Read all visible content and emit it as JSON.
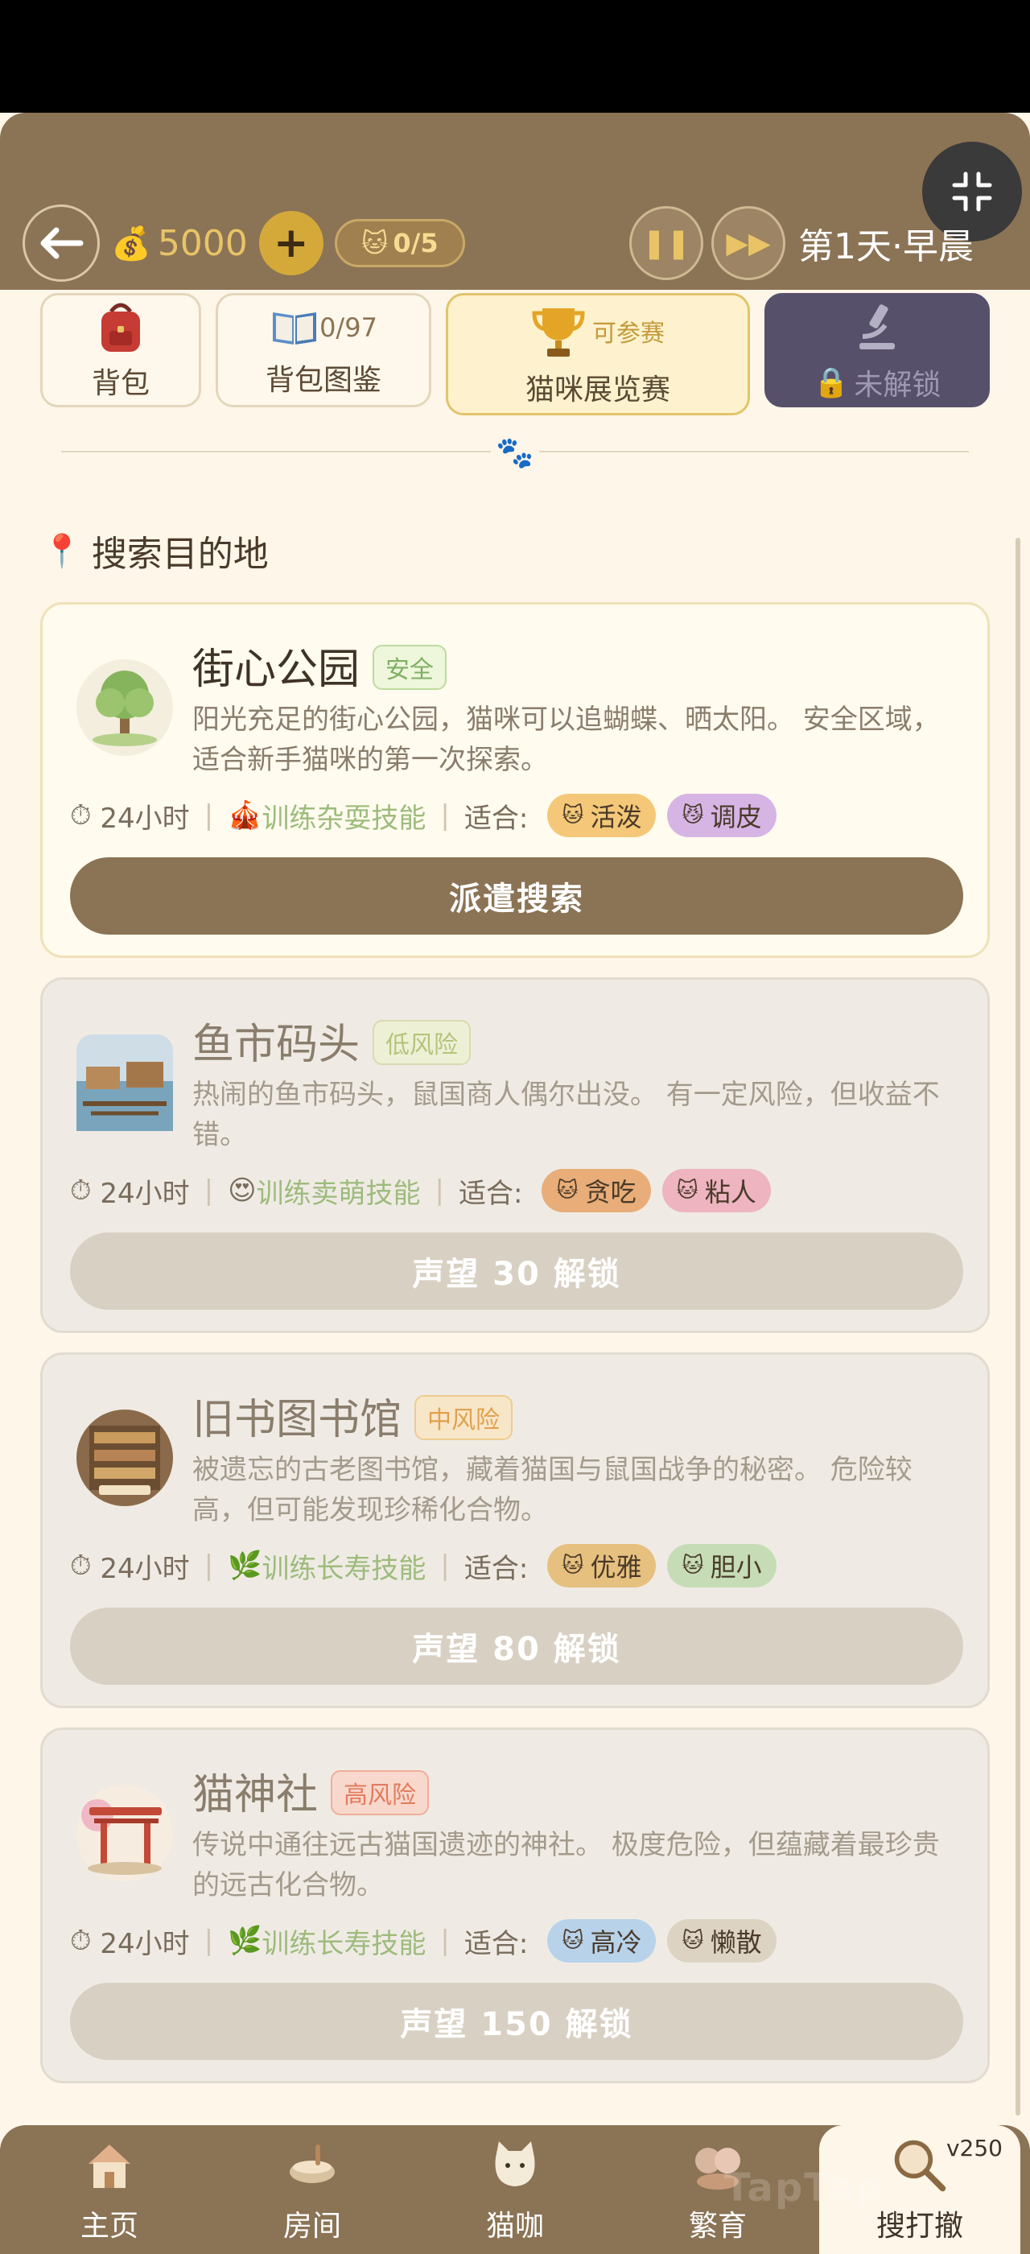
{
  "header": {
    "coins": "5000",
    "cats": "0/5",
    "day_label": "第1天·早晨"
  },
  "tools": {
    "bag_label": "背包",
    "codex_count": "0/97",
    "codex_label": "背包图鉴",
    "exhibition_tag": "可参赛",
    "exhibition_label": "猫咪展览赛",
    "locked_label": "未解锁"
  },
  "section_title": "搜索目的地",
  "destinations": [
    {
      "name": "街心公园",
      "risk": "安全",
      "risk_color": "#7fb063",
      "risk_bg": "#eef6dc",
      "desc": "阳光充足的街心公园，猫咪可以追蝴蝶、晒太阳。 安全区域，适合新手猫咪的第一次探索。",
      "duration": "24小时",
      "skill": "训练杂耍技能",
      "fit_label": "适合:",
      "traits": [
        {
          "label": "活泼",
          "color": "#f4c878"
        },
        {
          "label": "调皮",
          "color": "#d6b4e4"
        }
      ],
      "action": "派遣搜索",
      "locked": false
    },
    {
      "name": "鱼市码头",
      "risk": "低风险",
      "risk_color": "#b4c47a",
      "risk_bg": "#eef0d6",
      "desc": "热闹的鱼市码头，鼠国商人偶尔出没。 有一定风险，但收益不错。",
      "duration": "24小时",
      "skill": "训练卖萌技能",
      "fit_label": "适合:",
      "traits": [
        {
          "label": "贪吃",
          "color": "#e8ad78"
        },
        {
          "label": "粘人",
          "color": "#eeb4c0"
        }
      ],
      "action": "声望 30 解锁",
      "locked": true
    },
    {
      "name": "旧书图书馆",
      "risk": "中风险",
      "risk_color": "#e0a14e",
      "risk_bg": "#f8e6c8",
      "desc": "被遗忘的古老图书馆，藏着猫国与鼠国战争的秘密。 危险较高，但可能发现珍稀化合物。",
      "duration": "24小时",
      "skill": "训练长寿技能",
      "fit_label": "适合:",
      "traits": [
        {
          "label": "优雅",
          "color": "#e6c07e"
        },
        {
          "label": "胆小",
          "color": "#c6dcb6"
        }
      ],
      "action": "声望 80 解锁",
      "locked": true
    },
    {
      "name": "猫神社",
      "risk": "高风险",
      "risk_color": "#e27b5e",
      "risk_bg": "#f8d8cc",
      "desc": "传说中通往远古猫国遗迹的神社。 极度危险，但蕴藏着最珍贵的远古化合物。",
      "duration": "24小时",
      "skill": "训练长寿技能",
      "fit_label": "适合:",
      "traits": [
        {
          "label": "高冷",
          "color": "#b8d2ea"
        },
        {
          "label": "懒散",
          "color": "#ddd3c2"
        }
      ],
      "action": "声望 150 解锁",
      "locked": true
    }
  ],
  "nav": {
    "home": "主页",
    "room": "房间",
    "cafe": "猫咖",
    "breed": "繁育",
    "search": "搜打撤",
    "version": "v250"
  },
  "watermark": "TapTap"
}
